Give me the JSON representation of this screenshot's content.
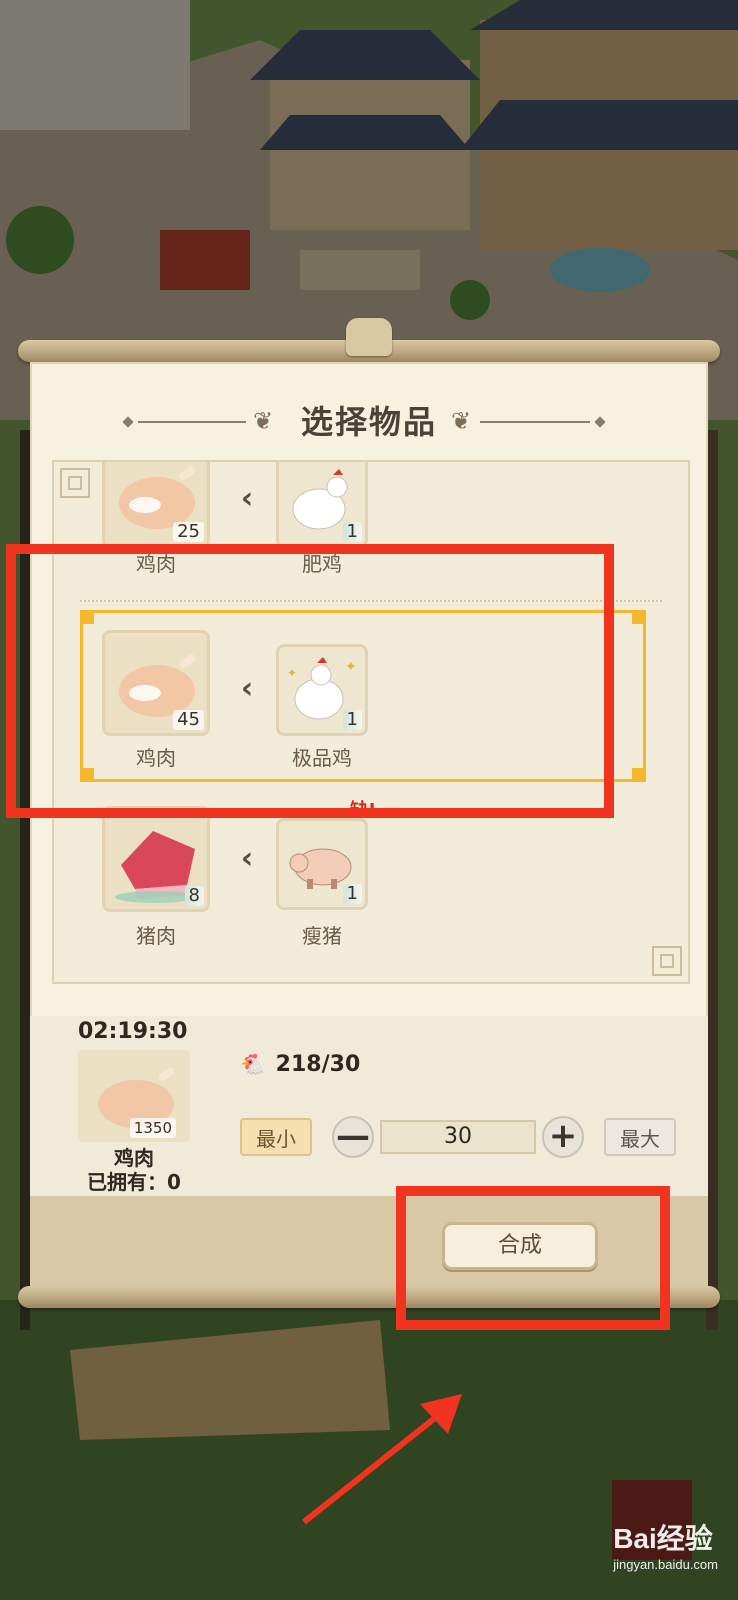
{
  "dialog": {
    "title": "选择物品"
  },
  "recipes": [
    {
      "output_name": "鸡肉",
      "output_count": "25",
      "input_name": "肥鸡",
      "input_count": "1",
      "selected": false,
      "missing": false
    },
    {
      "output_name": "鸡肉",
      "output_count": "45",
      "input_name": "极品鸡",
      "input_count": "1",
      "selected": true,
      "missing": false
    },
    {
      "output_name": "猪肉",
      "output_count": "8",
      "input_name": "瘦猪",
      "input_count": "1",
      "selected": false,
      "missing": true,
      "missing_label": "缺!"
    }
  ],
  "detail": {
    "timer": "02:19:30",
    "item_count": "1350",
    "item_name": "鸡肉",
    "owned_text": "已拥有：0",
    "requirement": "218/30",
    "min_label": "最小",
    "max_label": "最大",
    "quantity": "30",
    "decrement_symbol": "—",
    "increment_symbol": "+"
  },
  "footer": {
    "craft_label": "合成"
  },
  "watermark": {
    "brand": "Bai经验",
    "url": "jingyan.baidu.com"
  },
  "colors": {
    "selection": "#f5b72b",
    "annotation_red": "#f0341f",
    "panel_bg": "#f7f1e0"
  }
}
